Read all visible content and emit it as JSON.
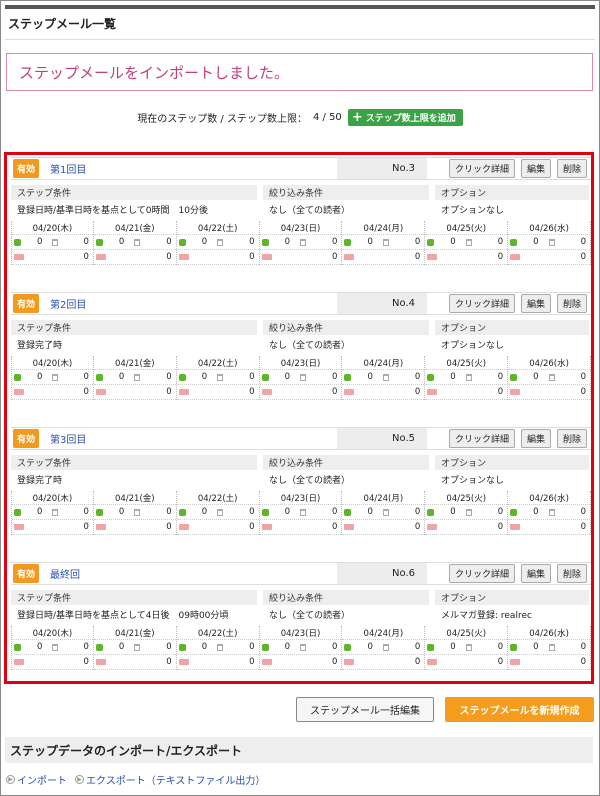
{
  "page": {
    "title": "ステップメール一覧"
  },
  "notice": {
    "message": "ステップメールをインポートしました。"
  },
  "step_info": {
    "label": "現在のステップ数 / ステップ数上限：",
    "count": "4 / 50",
    "add_limit_button": "ステップ数上限を追加"
  },
  "labels": {
    "active": "有効",
    "click_detail": "クリック詳細",
    "edit": "編集",
    "delete": "削除",
    "step_condition": "ステップ条件",
    "filter_condition": "絞り込み条件",
    "option": "オプション"
  },
  "dates": [
    "04/20(木)",
    "04/21(金)",
    "04/22(土)",
    "04/23(日)",
    "04/24(月)",
    "04/25(火)",
    "04/26(水)"
  ],
  "steps": [
    {
      "name": "第1回目",
      "no": "No.3",
      "step_condition": "登録日時/基準日時を基点として0時間　10分後",
      "filter_condition": "なし（全ての読者）",
      "option": "オプションなし"
    },
    {
      "name": "第2回目",
      "no": "No.4",
      "step_condition": "登録完了時",
      "filter_condition": "なし（全ての読者）",
      "option": "オプションなし"
    },
    {
      "name": "第3回目",
      "no": "No.5",
      "step_condition": "登録完了時",
      "filter_condition": "なし（全ての読者）",
      "option": "オプションなし"
    },
    {
      "name": "最終回",
      "no": "No.6",
      "step_condition": "登録日時/基準日時を基点として4日後　09時00分頃",
      "filter_condition": "なし（全ての読者）",
      "option": "メルマガ登録: realrec"
    }
  ],
  "cell_values": {
    "sent": "0",
    "deleted": "0",
    "mail": "0"
  },
  "buttons": {
    "bulk_edit": "ステップメール一括編集",
    "create_new": "ステップメールを新規作成"
  },
  "import_export": {
    "title": "ステップデータのインポート/エクスポート",
    "import_link": "インポート",
    "export_link": "エクスポート（テキストファイル出力）"
  }
}
